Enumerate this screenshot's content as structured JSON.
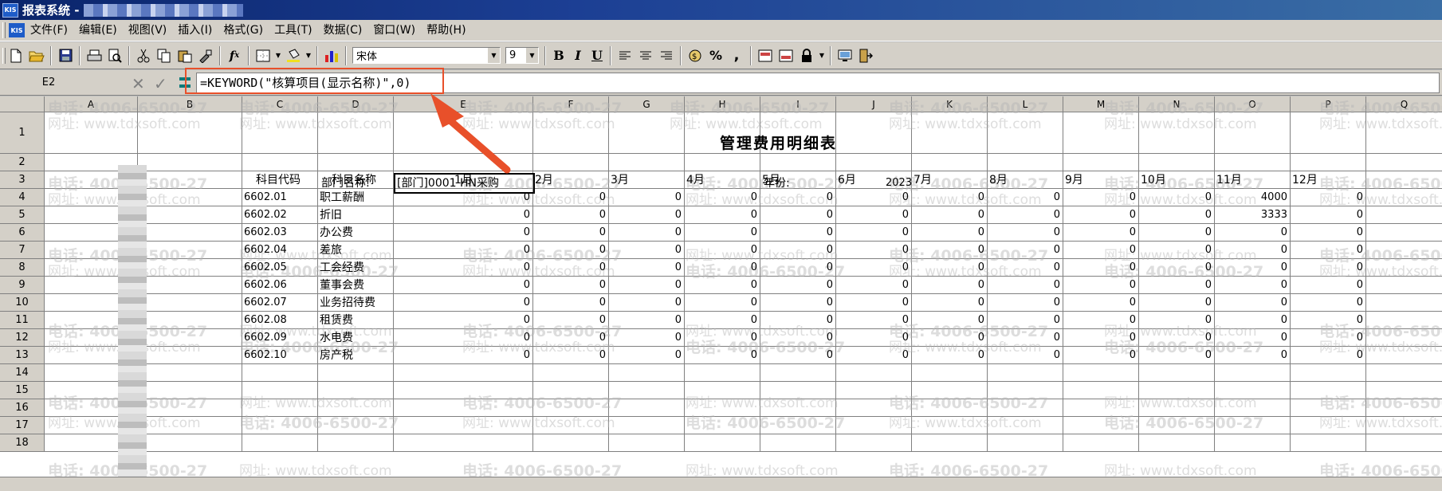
{
  "window": {
    "title": "报表系统 -"
  },
  "menu": [
    "文件(F)",
    "编辑(E)",
    "视图(V)",
    "插入(I)",
    "格式(G)",
    "工具(T)",
    "数据(C)",
    "窗口(W)",
    "帮助(H)"
  ],
  "toolbar": {
    "font": "宋体",
    "size": "9",
    "bold": "B",
    "italic": "I",
    "underline": "U",
    "percent": "%",
    "comma": ","
  },
  "formula": {
    "cell_ref": "E2",
    "text": "=KEYWORD(\"核算项目(显示名称)\",0)"
  },
  "columns": [
    "A",
    "B",
    "C",
    "D",
    "E",
    "F",
    "G",
    "H",
    "I",
    "J",
    "K",
    "L",
    "M",
    "N",
    "O",
    "P",
    "Q"
  ],
  "rows": [
    "1",
    "2",
    "3",
    "4",
    "5",
    "6",
    "7",
    "8",
    "9",
    "10",
    "11",
    "12",
    "13",
    "14",
    "15",
    "16",
    "17",
    "18"
  ],
  "report": {
    "title": "管理费用明细表",
    "dept_label": "部门名称:",
    "dept_value": "[部门]0001 HN采购",
    "year_label": "年份:",
    "year_value": "2023",
    "code_header": "科目代码",
    "name_header": "科目名称",
    "months": [
      "1月",
      "2月",
      "3月",
      "4月",
      "5月",
      "6月",
      "7月",
      "8月",
      "9月",
      "10月",
      "11月",
      "12月"
    ],
    "items": [
      {
        "code": "6602.01",
        "name": "职工薪酬",
        "values": [
          "0",
          "0",
          "0",
          "0",
          "0",
          "0",
          "0",
          "0",
          "0",
          "0",
          "4000",
          "0"
        ]
      },
      {
        "code": "6602.02",
        "name": "折旧",
        "values": [
          "0",
          "0",
          "0",
          "0",
          "0",
          "0",
          "0",
          "0",
          "0",
          "0",
          "3333",
          "0"
        ]
      },
      {
        "code": "6602.03",
        "name": "办公费",
        "values": [
          "0",
          "0",
          "0",
          "0",
          "0",
          "0",
          "0",
          "0",
          "0",
          "0",
          "0",
          "0"
        ]
      },
      {
        "code": "6602.04",
        "name": "差旅",
        "values": [
          "0",
          "0",
          "0",
          "0",
          "0",
          "0",
          "0",
          "0",
          "0",
          "0",
          "0",
          "0"
        ]
      },
      {
        "code": "6602.05",
        "name": "工会经费",
        "values": [
          "0",
          "0",
          "0",
          "0",
          "0",
          "0",
          "0",
          "0",
          "0",
          "0",
          "0",
          "0"
        ]
      },
      {
        "code": "6602.06",
        "name": "董事会费",
        "values": [
          "0",
          "0",
          "0",
          "0",
          "0",
          "0",
          "0",
          "0",
          "0",
          "0",
          "0",
          "0"
        ]
      },
      {
        "code": "6602.07",
        "name": "业务招待费",
        "values": [
          "0",
          "0",
          "0",
          "0",
          "0",
          "0",
          "0",
          "0",
          "0",
          "0",
          "0",
          "0"
        ]
      },
      {
        "code": "6602.08",
        "name": "租赁费",
        "values": [
          "0",
          "0",
          "0",
          "0",
          "0",
          "0",
          "0",
          "0",
          "0",
          "0",
          "0",
          "0"
        ]
      },
      {
        "code": "6602.09",
        "name": "水电费",
        "values": [
          "0",
          "0",
          "0",
          "0",
          "0",
          "0",
          "0",
          "0",
          "0",
          "0",
          "0",
          "0"
        ]
      },
      {
        "code": "6602.10",
        "name": "房产税",
        "values": [
          "0",
          "0",
          "0",
          "0",
          "0",
          "0",
          "0",
          "0",
          "0",
          "0",
          "0",
          "0"
        ]
      }
    ]
  },
  "watermark": {
    "phone": "电话: 4006-6500-27",
    "site": "网址: www.tdxsoft.com"
  }
}
